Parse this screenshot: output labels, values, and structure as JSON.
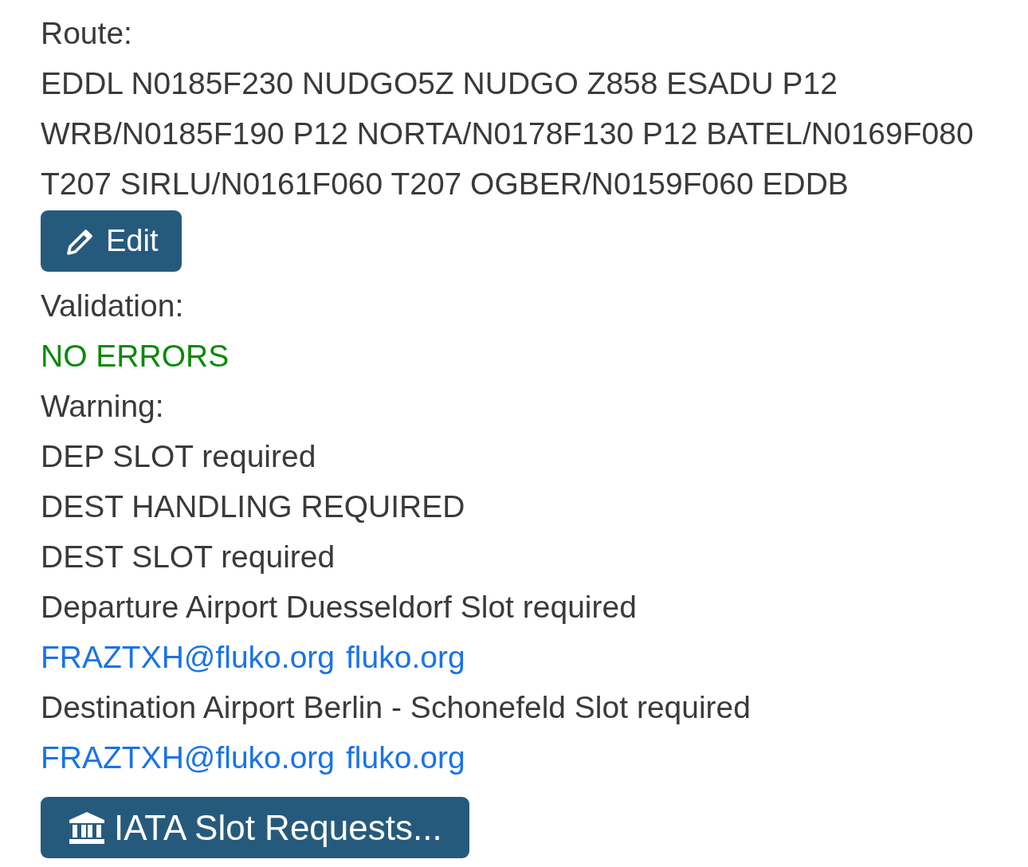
{
  "route": {
    "label": "Route:",
    "lines": [
      "EDDL N0185F230 NUDGO5Z NUDGO Z858 ESADU P12",
      "WRB/N0185F190 P12 NORTA/N0178F130 P12 BATEL/N0169F080",
      "T207 SIRLU/N0161F060 T207 OGBER/N0159F060 EDDB"
    ]
  },
  "edit_button": "Edit",
  "validation": {
    "label": "Validation:",
    "status": "NO ERRORS",
    "error": false
  },
  "warning": {
    "label": "Warning:",
    "items": [
      {
        "kind": "text",
        "text": "DEP SLOT required"
      },
      {
        "kind": "text",
        "text": "DEST HANDLING REQUIRED"
      },
      {
        "kind": "text",
        "text": "DEST SLOT required"
      },
      {
        "kind": "text",
        "text": "Departure Airport Duesseldorf Slot required"
      },
      {
        "kind": "links",
        "links": [
          "FRAZTXH@fluko.org",
          "fluko.org"
        ]
      },
      {
        "kind": "text",
        "text": "Destination Airport Berlin - Schonefeld Slot required"
      },
      {
        "kind": "links",
        "links": [
          "FRAZTXH@fluko.org",
          "fluko.org"
        ]
      }
    ]
  },
  "slot_button": "IATA Slot Requests..."
}
